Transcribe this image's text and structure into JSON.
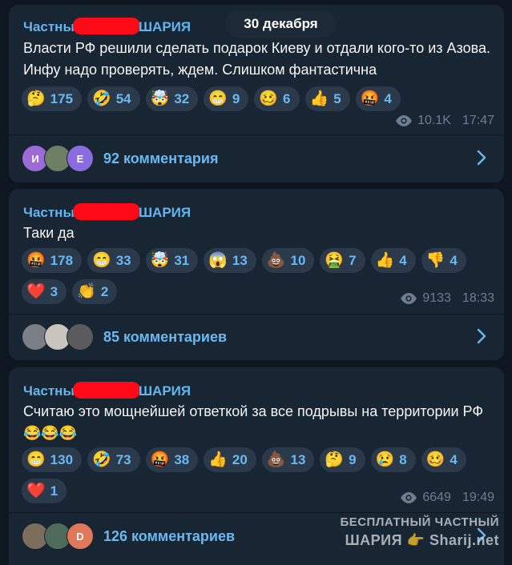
{
  "date_pill": "30 декабря",
  "posts": [
    {
      "channel_prefix": "Частны",
      "channel_suffix": "ШАРИЯ",
      "text": "Власти РФ решили сделать подарок Киеву и отдали кого-то из Азова. Инфу надо проверять, ждем. Слишком фантастична",
      "reactions": [
        {
          "emoji": "🤔",
          "count": "175"
        },
        {
          "emoji": "🤣",
          "count": "54"
        },
        {
          "emoji": "🤯",
          "count": "32"
        },
        {
          "emoji": "😁",
          "count": "9"
        },
        {
          "emoji": "🥴",
          "count": "6"
        },
        {
          "emoji": "👍",
          "count": "5"
        },
        {
          "emoji": "🤬",
          "count": "4"
        }
      ],
      "views": "10.1K",
      "time": "17:47",
      "avatars": [
        {
          "letter": "И",
          "color": "#9b6bd6"
        },
        {
          "letter": "",
          "color": "#6f7f63"
        },
        {
          "letter": "E",
          "color": "#8a6be0"
        }
      ],
      "comments_label": "92 комментария"
    },
    {
      "channel_prefix": "Частны",
      "channel_suffix": "ШАРИЯ",
      "text": "Таки да",
      "reactions": [
        {
          "emoji": "🤬",
          "count": "178"
        },
        {
          "emoji": "😁",
          "count": "33"
        },
        {
          "emoji": "🤯",
          "count": "31"
        },
        {
          "emoji": "😱",
          "count": "13"
        },
        {
          "emoji": "💩",
          "count": "10"
        },
        {
          "emoji": "🤮",
          "count": "7"
        },
        {
          "emoji": "👍",
          "count": "4"
        },
        {
          "emoji": "👎",
          "count": "4"
        },
        {
          "emoji": "❤️",
          "count": "3"
        },
        {
          "emoji": "👏",
          "count": "2"
        }
      ],
      "views": "9133",
      "time": "18:33",
      "avatars": [
        {
          "letter": "",
          "color": "#7a7f86"
        },
        {
          "letter": "",
          "color": "#c9c4bd"
        },
        {
          "letter": "",
          "color": "#5b5b5e"
        }
      ],
      "comments_label": "85 комментариев"
    },
    {
      "channel_prefix": "Частны",
      "channel_suffix": "ШАРИЯ",
      "text": "Считаю это мощнейшей ответкой за все подрывы на территории РФ😂😂😂",
      "reactions": [
        {
          "emoji": "😁",
          "count": "130"
        },
        {
          "emoji": "🤣",
          "count": "73"
        },
        {
          "emoji": "🤬",
          "count": "38"
        },
        {
          "emoji": "👍",
          "count": "20"
        },
        {
          "emoji": "💩",
          "count": "13"
        },
        {
          "emoji": "🤔",
          "count": "9"
        },
        {
          "emoji": "😢",
          "count": "8"
        },
        {
          "emoji": "🥴",
          "count": "4"
        },
        {
          "emoji": "❤️",
          "count": "1"
        }
      ],
      "views": "6649",
      "time": "19:49",
      "avatars": [
        {
          "letter": "",
          "color": "#7d6d5d"
        },
        {
          "letter": "",
          "color": "#4f6a59"
        },
        {
          "letter": "D",
          "color": "#e0785a"
        }
      ],
      "comments_label": "126 комментариев"
    }
  ],
  "watermark": {
    "line1": "БЕСПЛАТНЫЙ ЧАСТНЫЙ",
    "line2": "ШАРИЯ 👉 Sharij.net"
  },
  "icons": {
    "views": "eye-icon",
    "open": "chevron-right-icon",
    "redaction": "redaction-bar"
  }
}
